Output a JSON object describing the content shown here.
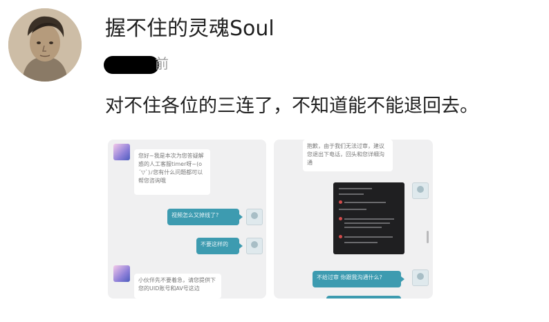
{
  "post": {
    "username": "握不住的灵魂Soul",
    "timestamp_suffix": "前",
    "comment": "对不住各位的三连了，不知道能不能退回去。"
  },
  "screenshot_left": {
    "msg1": "您好~我是本次为您答疑解惑的人工客服timer呀~(o´▽`)ﾉ您有什么问题都可以帮您咨询哦",
    "sent1": "视频怎么又掉线了?",
    "sent2": "不要这样的",
    "msg2": "小伙伴先不要着急，请您提供下您的UID账号和AV号这边"
  },
  "screenshot_right": {
    "msg1": "抱歉，由于我们无法过审，建议您退出下电话，回头和您详细沟通",
    "sent1": "不给过审 你跟我沟通什么?"
  }
}
